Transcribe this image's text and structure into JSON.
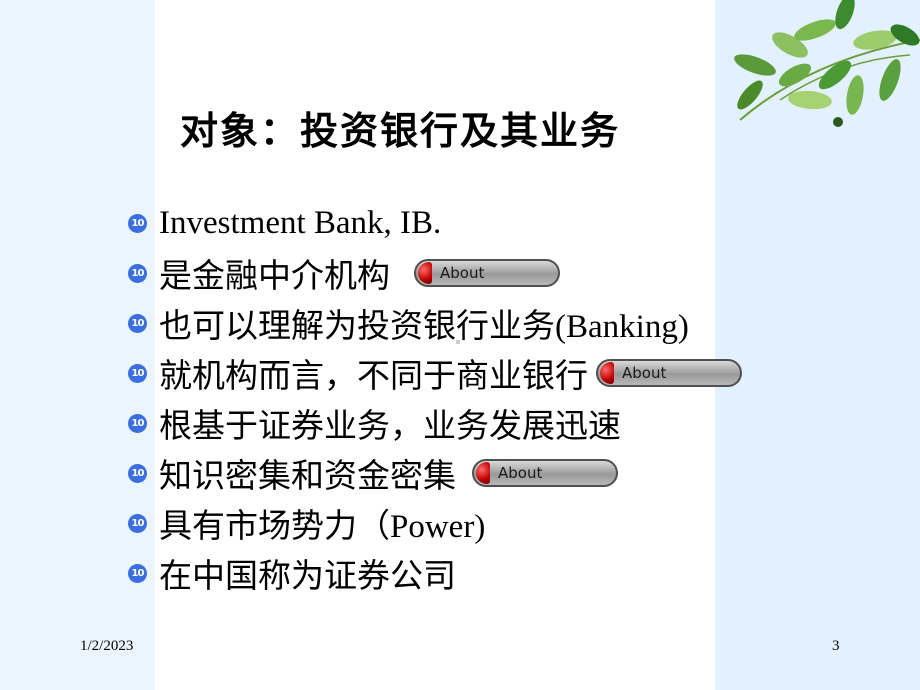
{
  "slide": {
    "title": "对象：投资银行及其业务",
    "bullet_icon": "circled-number-10-icon",
    "bullet_icon_text": "10",
    "bullets": [
      {
        "text": "Investment Bank, IB.",
        "button": null
      },
      {
        "text": "是金融中介机构",
        "button": "About"
      },
      {
        "text": "也可以理解为投资银行业务(Banking)",
        "button": null
      },
      {
        "text": "就机构而言，不同于商业银行",
        "button": "About"
      },
      {
        "text": "根基于证券业务，业务发展迅速",
        "button": null
      },
      {
        "text": "知识密集和资金密集",
        "button": "About"
      },
      {
        "text": "具有市场势力（Power)",
        "button": null
      },
      {
        "text": "在中国称为证券公司",
        "button": null
      }
    ],
    "footer": {
      "date": "1/2/2023",
      "page_number": "3"
    },
    "colors": {
      "left_band": "#ebf5fe",
      "right_band": "#e3f0fd",
      "bullet": "#3b6fe0",
      "button_led": "#c00000"
    }
  }
}
